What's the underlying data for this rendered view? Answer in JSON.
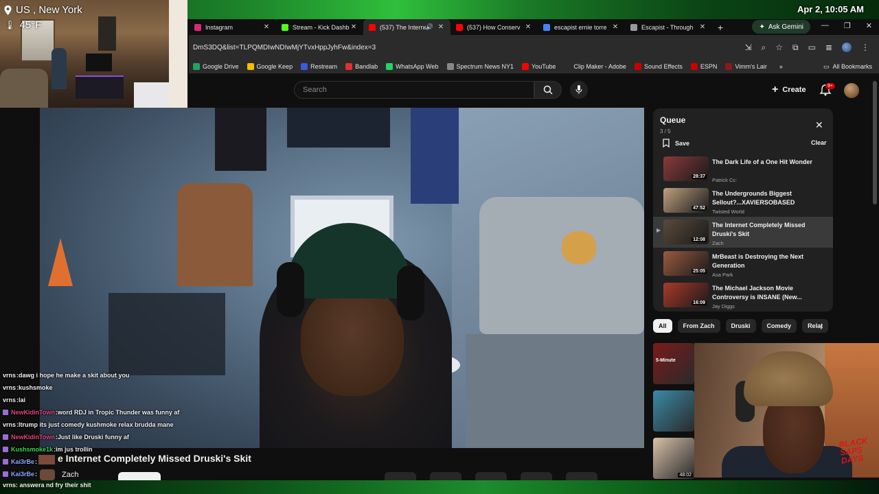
{
  "overlay": {
    "location": "US , New York",
    "temperature": "45°F",
    "datetime": "Apr 2, 10:05 AM"
  },
  "browser": {
    "tabs": [
      {
        "title": "Instagram",
        "color": "#d62976"
      },
      {
        "title": "Stream - Kick Dashb",
        "color": "#53fc18"
      },
      {
        "title": "(537) The Interne",
        "color": "#ff0000",
        "active": true
      },
      {
        "title": "(537) How Conserv",
        "color": "#ff0000"
      },
      {
        "title": "escapist ernie torre",
        "color": "#4285f4"
      },
      {
        "title": "Escapist - Through",
        "color": "#9a9a9a"
      }
    ],
    "ask_gemini": "Ask Gemini",
    "url": "DmS3DQ&list=TLPQMDIwNDIwMjYTvxHppJyhFw&index=3",
    "bookmarks": [
      {
        "label": "Google Drive",
        "color": "#1fa463"
      },
      {
        "label": "Google Keep",
        "color": "#fbbc04"
      },
      {
        "label": "Restream",
        "color": "#3b5bdb"
      },
      {
        "label": "Bandlab",
        "color": "#e03131"
      },
      {
        "label": "WhatsApp Web",
        "color": "#25d366"
      },
      {
        "label": "Spectrum News NY1",
        "color": "#888888"
      },
      {
        "label": "YouTube",
        "color": "#ff0000"
      },
      {
        "label": "Clip Maker - Adobe",
        "color": "#2b2b2b"
      },
      {
        "label": "Sound Effects",
        "color": "#cc0000"
      },
      {
        "label": "ESPN",
        "color": "#cc0000"
      },
      {
        "label": "Vimm's Lair",
        "color": "#8b1a1a"
      }
    ],
    "all_bookmarks": "All Bookmarks"
  },
  "youtube": {
    "search_placeholder": "Search",
    "create_label": "Create",
    "notif_count": "9+",
    "video_title": "e Internet Completely Missed Druski's Skit",
    "channel": "Zach",
    "queue": {
      "title": "Queue",
      "count": "3 / 5",
      "save": "Save",
      "clear": "Clear",
      "items": [
        {
          "title": "The Dark Life of a One Hit Wonder",
          "channel": "Patrick Cc:",
          "duration": "28:37",
          "thumb": "#8a3a3a"
        },
        {
          "title": "The Undergrounds Biggest Sellout?...XAVIERSOBASED",
          "channel": "Twisted World",
          "duration": "47:52",
          "thumb": "#c0a080"
        },
        {
          "title": "The Internet Completely Missed Druski's Skit",
          "channel": "Zach",
          "duration": "12:08",
          "thumb": "#5a4a3a",
          "current": true
        },
        {
          "title": "MrBeast is Destroying the Next Generation",
          "channel": "Asa Park",
          "duration": "25:05",
          "thumb": "#9a5a40"
        },
        {
          "title": "The Michael Jackson Movie Controversy is INSANE (New...",
          "channel": "Jay Diggs",
          "duration": "16:09",
          "thumb": "#a83a2a"
        }
      ]
    },
    "chips": [
      {
        "label": "All",
        "on": true
      },
      {
        "label": "From Zach"
      },
      {
        "label": "Druski"
      },
      {
        "label": "Comedy"
      },
      {
        "label": "Relat"
      }
    ],
    "recs": [
      {
        "tag": "5-Minute",
        "duration": "",
        "color": "#7a1a1a"
      },
      {
        "tag": "",
        "duration": "",
        "color": "#3a8aa8"
      },
      {
        "tag": "",
        "duration": "48:02",
        "color": "#d8c0a8"
      }
    ]
  },
  "chat": [
    {
      "user": "vrns",
      "text": "dawg i hope he make a skit about you",
      "color": "#f1f1f1",
      "badge": false
    },
    {
      "user": "vrns",
      "text": "kushsmoke",
      "color": "#f1f1f1",
      "badge": false
    },
    {
      "user": "vrns",
      "text": "lai",
      "color": "#f1f1f1",
      "badge": false
    },
    {
      "user": "NewKidinTown",
      "text": "word RDJ in Tropic Thunder was funny af",
      "color": "#e0457b",
      "badge": true
    },
    {
      "user": "vrns",
      "text": "ltrump its just comedy kushmoke relax brudda mane",
      "color": "#f1f1f1",
      "badge": false
    },
    {
      "user": "NewKidinTown",
      "text": "Just like Druski funny af",
      "color": "#e0457b",
      "badge": true
    },
    {
      "user": "Kushsmoke1k",
      "text": "im jus trollin",
      "color": "#3cd65a",
      "badge": true
    },
    {
      "user": "Kai3rBe",
      "text": "",
      "color": "#8fa8ff",
      "badge": true
    },
    {
      "user": "Kai3rBe",
      "text": "",
      "color": "#8fa8ff",
      "badge": true
    }
  ],
  "chat_footer": {
    "user": "vrns",
    "text": "answera nd fry their shit"
  },
  "cam2_sign": "BLACK SAPS DAYS"
}
